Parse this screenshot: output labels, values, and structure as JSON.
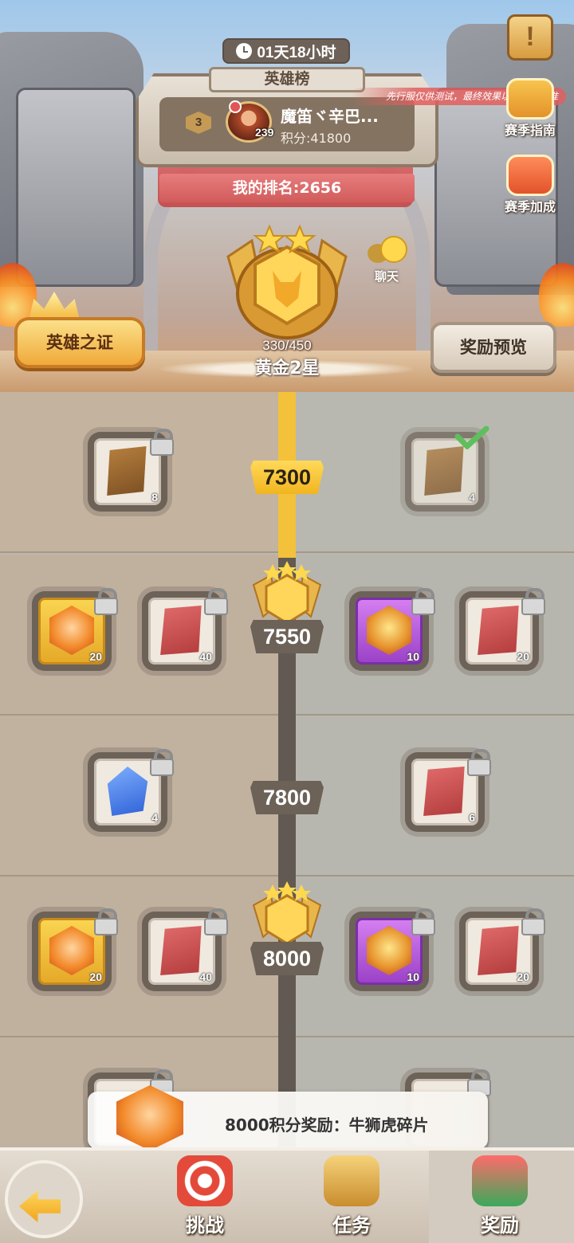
{
  "header": {
    "timer": "01天18小时",
    "board_title": "英雄榜",
    "top_rank": "3",
    "top_player_name": "魔笛ヾ辛巴...",
    "top_player_level": "239",
    "top_player_score": "积分:41800",
    "test_notice": "先行服仅供测试，最终效果以正式服为准",
    "my_rank": "我的排名:2656",
    "progress": "330/450",
    "tier": "黄金2星",
    "season_guide_label": "赛季指南",
    "season_bonus_label": "赛季加成",
    "chat_label": "聊天",
    "hero_proof_label": "英雄之证",
    "reward_preview_label": "奖励预览"
  },
  "track": {
    "rows": [
      {
        "score": "7300",
        "left": [
          {
            "qty": "8"
          }
        ],
        "right": [
          {
            "qty": "4"
          }
        ]
      },
      {
        "score": "7550",
        "left": [
          {
            "qty": "20"
          },
          {
            "qty": "40"
          }
        ],
        "right": [
          {
            "qty": "10"
          },
          {
            "qty": "20"
          }
        ]
      },
      {
        "score": "7800",
        "left": [
          {
            "qty": "4"
          }
        ],
        "right": [
          {
            "qty": "6"
          }
        ]
      },
      {
        "score": "8000",
        "left": [
          {
            "qty": "20"
          },
          {
            "qty": "40"
          }
        ],
        "right": [
          {
            "qty": "10"
          },
          {
            "qty": "20"
          }
        ]
      }
    ]
  },
  "toast": {
    "text": "8000积分奖励：牛狮虎碎片"
  },
  "bottom_nav": {
    "tabs": [
      {
        "label": "挑战"
      },
      {
        "label": "任务"
      },
      {
        "label": "奖励"
      }
    ]
  },
  "colors": {
    "gold": "#f3c23a",
    "purple": "#9b42c8",
    "accent_red": "#d15b5b"
  }
}
